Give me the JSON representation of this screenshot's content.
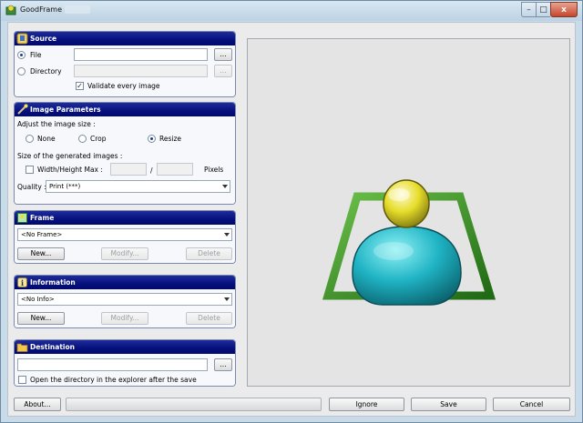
{
  "window": {
    "title": "GoodFrame"
  },
  "title_buttons": {
    "minimize": "–",
    "maximize": "□",
    "close": "x"
  },
  "source": {
    "header": "Source",
    "file_label": "File",
    "directory_label": "Directory",
    "browse_label": "...",
    "file_value": "",
    "directory_value": "",
    "validate_label": "Validate every image",
    "validate_checked": true,
    "selected": "File"
  },
  "image_params": {
    "header": "Image Parameters",
    "adjust_label": "Adjust the image size :",
    "options": [
      "None",
      "Crop",
      "Resize"
    ],
    "selected": "Resize",
    "size_label": "Size of the generated images :",
    "wh_label": "Width/Height Max :",
    "wh_checked": false,
    "width_value": "",
    "height_value": "",
    "separator": "/",
    "units": "Pixels",
    "quality_label": "Quality :",
    "quality_value": "Print (***)"
  },
  "frame": {
    "header": "Frame",
    "select_value": "<No Frame>",
    "new_label": "New...",
    "modify_label": "Modify...",
    "delete_label": "Delete"
  },
  "information": {
    "header": "Information",
    "select_value": "<No Info>",
    "new_label": "New...",
    "modify_label": "Modify...",
    "delete_label": "Delete"
  },
  "destination": {
    "header": "Destination",
    "path_value": "",
    "browse_label": "...",
    "open_label": "Open the directory in the explorer after the save",
    "open_checked": false
  },
  "footer": {
    "about_label": "About...",
    "progress": 0,
    "ignore_label": "Ignore",
    "save_label": "Save",
    "cancel_label": "Cancel"
  },
  "colors": {
    "group_header": "#06107c",
    "client_bg": "#ebebeb",
    "preview_bg": "#e4e4e4",
    "frame_green": "#2f8a1f",
    "head_yellow": "#e6dd2a",
    "body_cyan": "#1fb3c4"
  },
  "icons": {
    "app": "app-icon",
    "source": "source-icon",
    "image_params": "wand-icon",
    "frame": "frame-icon",
    "information": "info-icon",
    "destination": "folder-icon",
    "preview": "user-in-frame-icon"
  }
}
